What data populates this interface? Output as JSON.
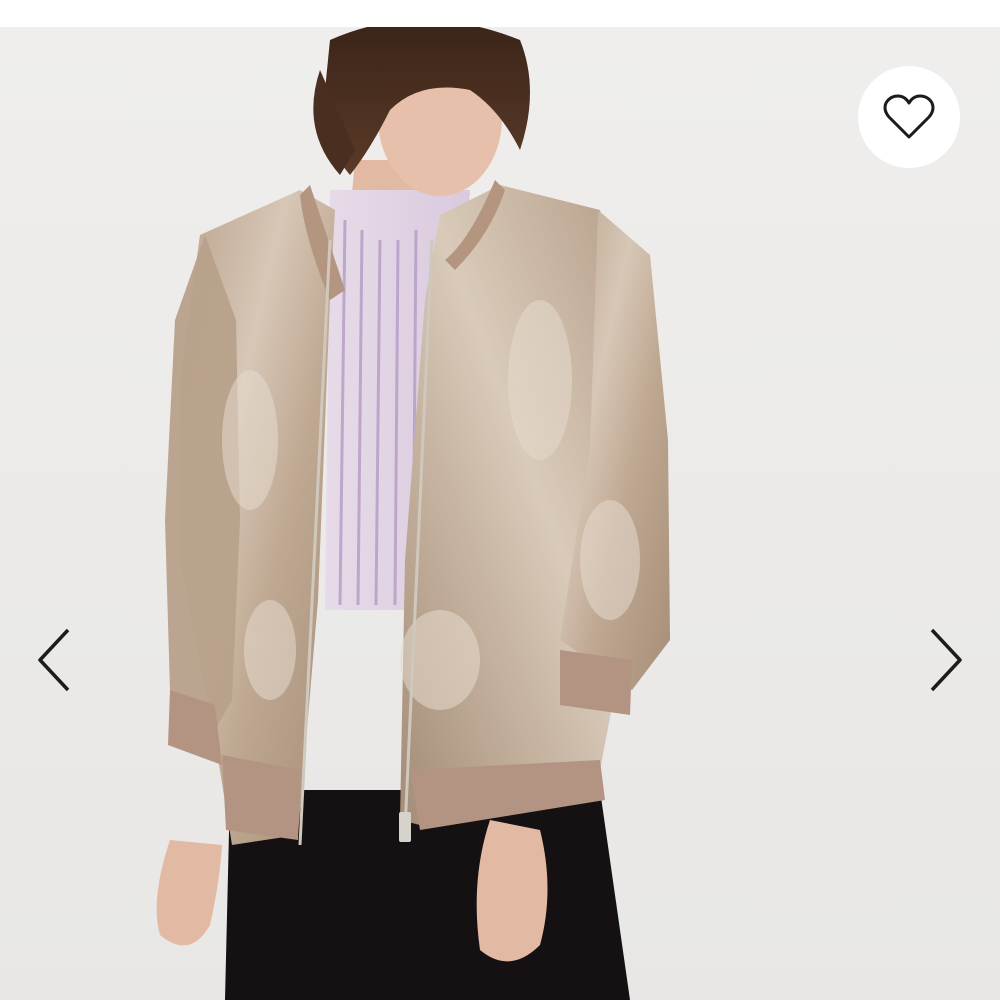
{
  "gallery": {
    "image": {
      "subject": "model-wearing-velvet-bomber-jacket",
      "background_color": "#ECEBE9",
      "jacket_color": "#C4AE98",
      "shirt_color": "#E4D8E6",
      "skirt_color": "#141012"
    },
    "favorite_button": {
      "icon": "heart-outline-icon",
      "color": "#1c1c1c"
    },
    "prev_button": {
      "icon": "chevron-left-icon",
      "color": "#1c1c1c"
    },
    "next_button": {
      "icon": "chevron-right-icon",
      "color": "#1c1c1c"
    }
  }
}
